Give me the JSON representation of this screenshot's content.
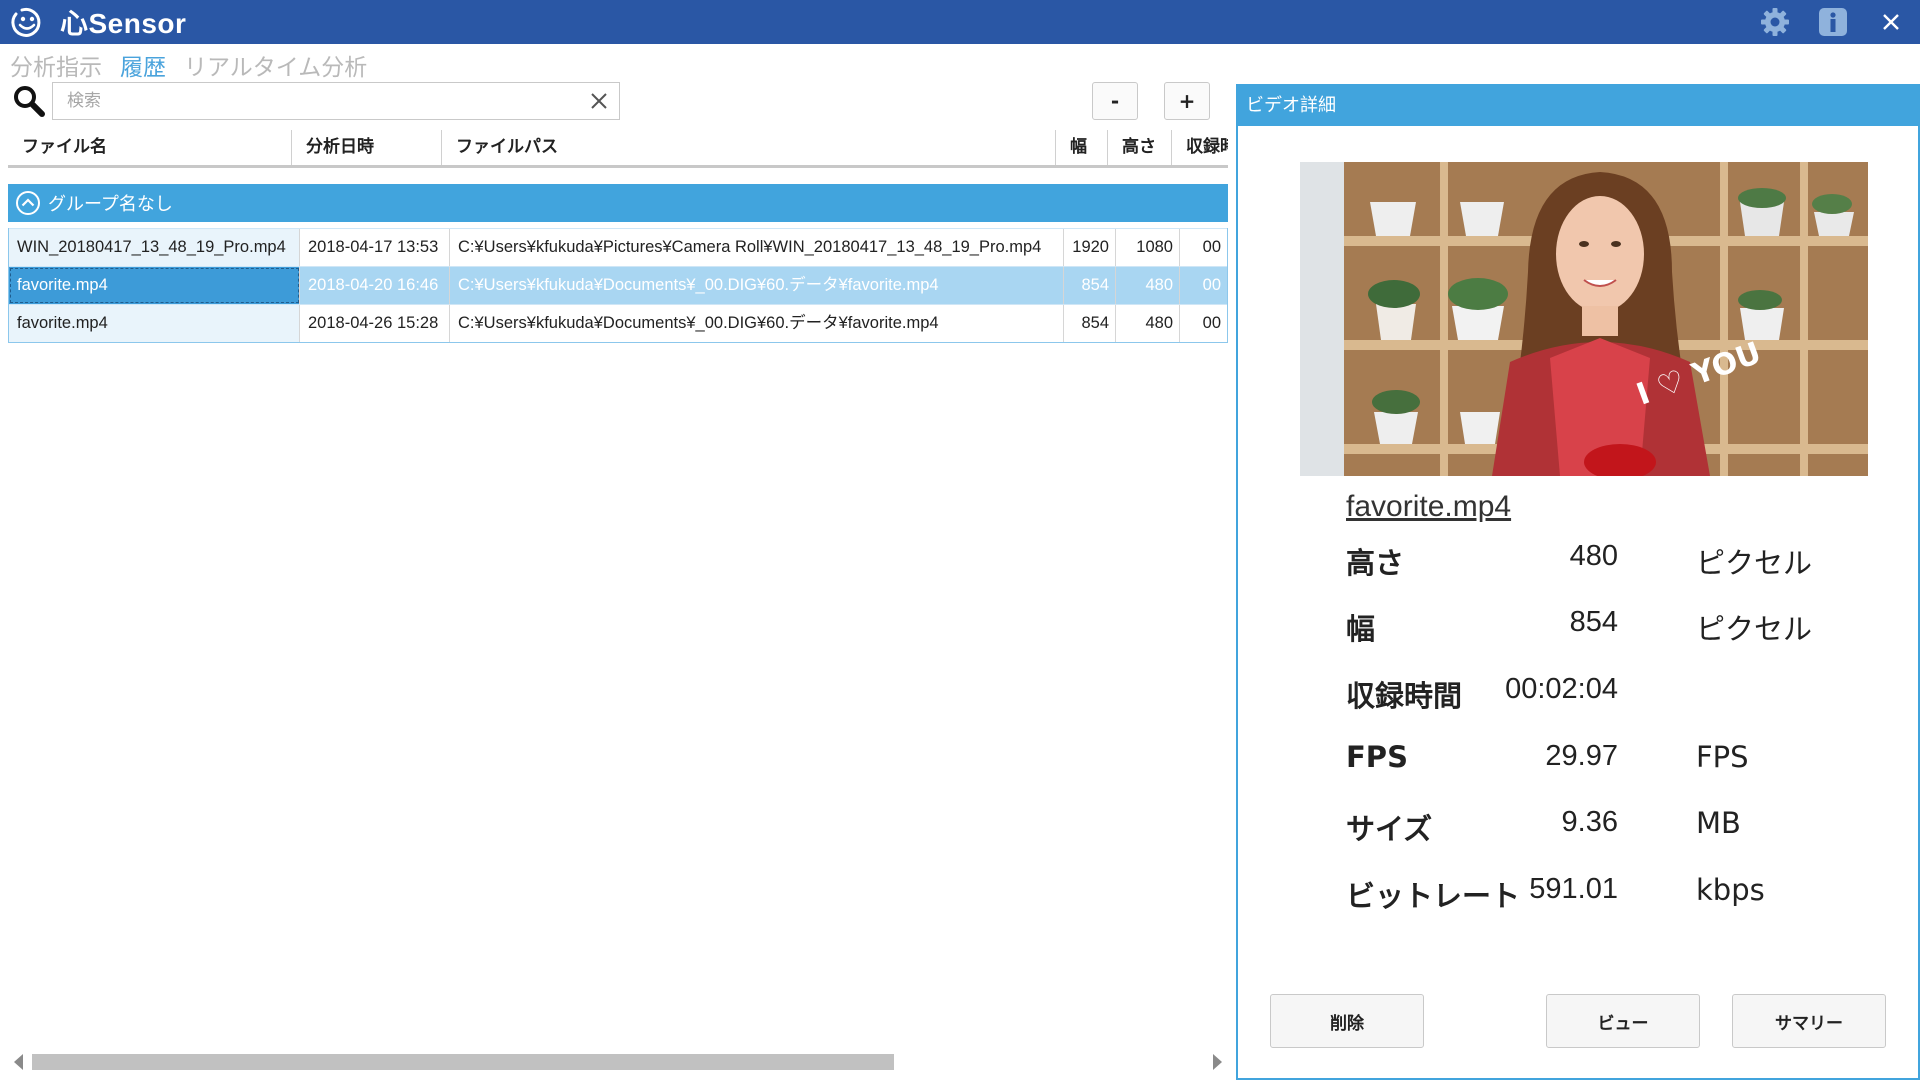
{
  "app": {
    "title": "心Sensor"
  },
  "nav": {
    "tabs": [
      "分析指示",
      "履歴",
      "リアルタイム分析"
    ],
    "active": 1
  },
  "search": {
    "placeholder": "検索",
    "value": ""
  },
  "zoom": {
    "minus": "-",
    "plus": "+"
  },
  "table": {
    "columns": [
      "ファイル名",
      "分析日時",
      "ファイルパス",
      "幅",
      "高さ",
      "収録時"
    ],
    "group": "グループ名なし",
    "rows": [
      [
        "WIN_20180417_13_48_19_Pro.mp4",
        "2018-04-17 13:53",
        "C:¥Users¥kfukuda¥Pictures¥Camera Roll¥WIN_20180417_13_48_19_Pro.mp4",
        "1920",
        "1080",
        "00"
      ],
      [
        "favorite.mp4",
        "2018-04-20 16:46",
        "C:¥Users¥kfukuda¥Documents¥_00.DIG¥60.データ¥favorite.mp4",
        "854",
        "480",
        "00"
      ],
      [
        "favorite.mp4",
        "2018-04-26 15:28",
        "C:¥Users¥kfukuda¥Documents¥_00.DIG¥60.データ¥favorite.mp4",
        "854",
        "480",
        "00"
      ]
    ],
    "selected_row": 1
  },
  "detail": {
    "title": "ビデオ詳細",
    "file_name": "favorite.mp4",
    "thumbnail_text": "I ♡ YOU",
    "properties": [
      {
        "label": "高さ",
        "value": "480",
        "unit": "ピクセル"
      },
      {
        "label": "幅",
        "value": "854",
        "unit": "ピクセル"
      },
      {
        "label": "収録時間",
        "value": "00:02:04",
        "unit": ""
      },
      {
        "label": "FPS",
        "value": "29.97",
        "unit": "FPS"
      },
      {
        "label": "サイズ",
        "value": "9.36",
        "unit": "MB"
      },
      {
        "label": "ビットレート",
        "value": "591.01",
        "unit": "kbps"
      }
    ],
    "buttons": {
      "delete": "削除",
      "view": "ビュー",
      "summary": "サマリー"
    }
  },
  "colors": {
    "titlebar": "#2a57a5",
    "accent": "#41a4dd",
    "selected": "#3d9bd8",
    "active_tab": "#4aa3dc"
  },
  "icons": [
    "smile-logo-icon",
    "gear-icon",
    "info-icon",
    "close-icon",
    "search-icon",
    "clear-icon",
    "chevron-up-circle-icon"
  ]
}
